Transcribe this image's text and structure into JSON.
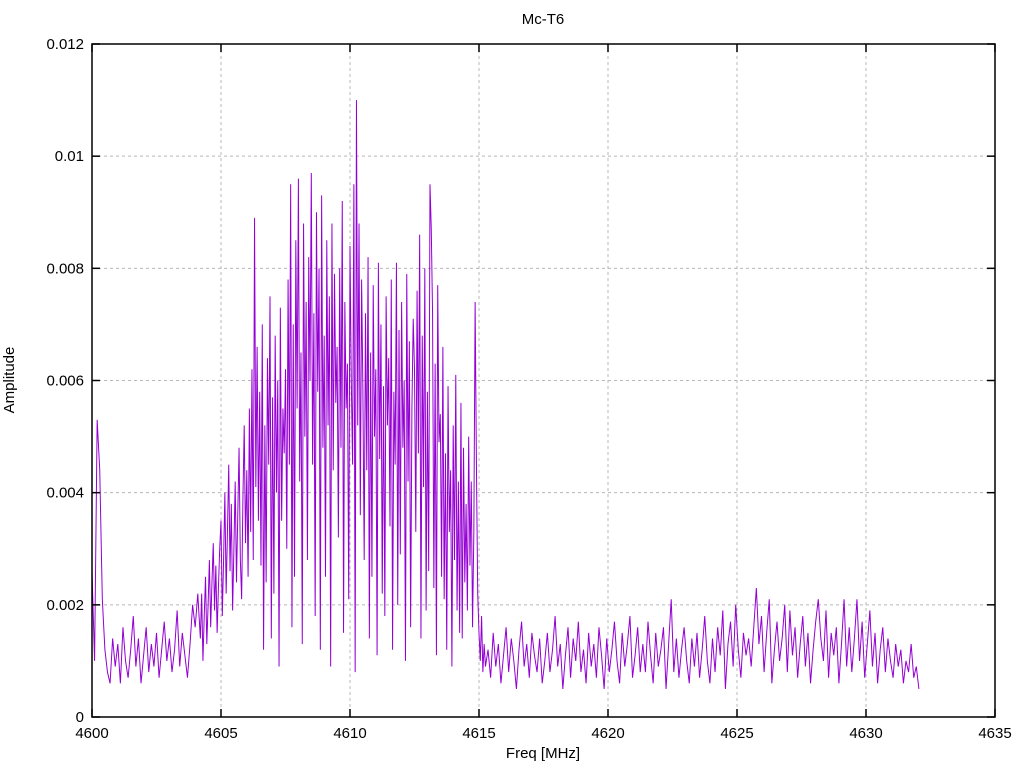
{
  "chart_data": {
    "type": "line",
    "title": "Mc-T6",
    "xlabel": "Freq [MHz]",
    "ylabel": "Amplitude",
    "xlim": [
      4600,
      4635
    ],
    "ylim": [
      0,
      0.012
    ],
    "x_ticks": [
      4600,
      4605,
      4610,
      4615,
      4620,
      4625,
      4630,
      4635
    ],
    "y_ticks": [
      0,
      0.002,
      0.004,
      0.006,
      0.008,
      0.01,
      0.012
    ],
    "grid": true,
    "legend": false,
    "line_color": "#9400d3",
    "grid_color": "#b8b8b8",
    "border_color": "#000000",
    "background_color": "#ffffff",
    "value_scale": 0.0001,
    "segments": [
      {
        "x0": 4600.0,
        "dx": 0.1,
        "values": [
          26,
          10,
          53,
          44,
          21,
          12,
          8,
          6,
          14,
          9,
          13,
          6,
          16,
          10,
          7,
          12,
          18,
          9,
          14,
          6,
          11,
          16,
          8,
          13,
          9,
          15,
          7,
          12,
          17,
          10,
          14,
          8,
          12,
          19,
          9,
          15,
          11,
          7,
          13,
          20,
          16,
          22
        ]
      },
      {
        "x0": 4604.2,
        "dx": 0.05,
        "values": [
          14,
          22,
          10,
          18,
          25,
          13,
          20,
          28,
          16,
          24,
          31,
          19,
          27,
          15,
          23,
          30,
          35,
          18,
          28,
          40,
          22,
          33,
          45,
          26,
          38,
          19,
          30,
          42,
          24,
          36,
          48,
          28,
          21,
          39,
          52,
          31,
          44,
          25,
          55,
          33,
          62,
          28,
          89,
          41,
          66,
          35,
          58,
          27,
          70,
          12,
          52,
          24,
          64,
          45,
          75,
          14,
          57,
          22,
          68,
          40,
          60,
          9,
          73,
          35,
          55,
          47,
          62,
          30,
          78,
          45,
          95,
          16,
          70,
          25,
          85,
          55,
          96,
          42,
          65,
          13,
          88,
          50,
          74,
          28,
          82,
          60,
          97,
          45,
          72,
          18,
          90,
          58,
          80,
          12,
          93,
          48,
          68,
          25,
          85,
          52,
          75,
          9,
          88,
          44,
          79,
          56,
          66,
          32,
          80,
          48,
          92,
          15,
          74,
          55,
          63,
          21,
          84,
          60,
          45,
          95,
          8,
          110,
          52,
          88,
          36,
          78,
          58,
          28,
          72,
          44,
          82,
          14,
          65,
          25,
          77,
          50,
          62,
          11,
          81,
          46,
          70,
          22,
          59,
          18,
          75,
          52,
          64,
          34,
          78,
          12,
          58,
          45,
          81,
          20,
          69,
          29,
          74,
          48,
          60,
          10,
          79,
          42,
          67,
          16,
          55,
          71,
          62,
          33,
          76,
          47,
          86,
          14,
          68,
          41,
          80,
          19,
          58,
          26,
          95,
          87,
          72,
          23,
          63,
          11,
          77,
          49,
          54,
          25,
          66,
          21,
          47,
          12,
          59,
          33,
          44,
          9,
          52,
          28,
          61,
          19,
          42,
          15,
          56,
          14,
          48,
          24,
          38,
          19,
          50,
          27,
          42,
          16,
          33,
          74,
          45,
          22,
          15,
          10,
          18,
          8,
          13,
          9
        ]
      },
      {
        "x0": 4615.35,
        "dx": 0.1,
        "values": [
          12,
          7,
          15,
          9,
          13,
          6,
          11,
          16,
          8,
          14,
          10,
          5,
          12,
          17,
          9,
          13,
          7,
          15,
          11,
          8,
          14,
          6,
          10,
          15,
          8,
          12,
          18,
          9,
          13,
          5,
          11,
          16,
          7,
          14,
          10,
          17,
          8,
          12,
          6,
          15,
          9,
          13,
          7,
          16,
          11,
          5,
          14,
          8,
          12,
          17,
          10,
          6,
          15,
          9,
          13,
          18,
          7,
          11,
          16,
          8,
          13,
          8,
          17,
          11,
          6,
          15,
          9,
          12,
          16,
          5,
          13,
          21,
          8,
          14,
          7,
          12,
          16,
          10,
          6,
          14,
          9,
          15,
          7,
          12,
          18,
          10,
          6,
          14,
          8,
          16,
          11,
          19,
          5,
          13,
          17,
          9,
          20,
          12,
          7,
          15,
          11,
          14,
          9,
          16,
          23,
          13,
          18,
          8,
          15,
          21,
          6,
          12,
          17,
          10,
          14,
          20,
          8,
          19,
          11,
          16,
          7,
          13,
          18,
          9,
          15,
          6,
          12,
          17,
          21,
          14,
          10,
          19,
          7,
          15,
          11,
          16,
          6,
          13,
          21,
          9,
          16,
          8,
          14,
          21,
          10,
          17,
          7,
          13,
          19,
          9,
          15,
          6,
          12,
          16,
          8,
          14,
          10,
          7,
          13,
          9,
          12,
          6,
          10,
          8,
          13,
          7,
          9,
          5
        ]
      }
    ]
  }
}
